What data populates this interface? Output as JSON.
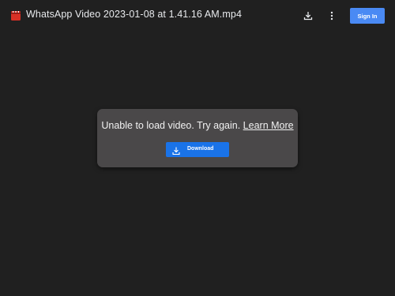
{
  "header": {
    "file_title": "WhatsApp Video 2023-01-08 at 1.41.16 AM.mp4",
    "file_icon": "video-file-icon",
    "download_icon": "download-icon",
    "more_icon": "more-vert-icon",
    "signin_label": "Sign In"
  },
  "error": {
    "message": "Unable to load video. Try again.",
    "learn_more": "Learn More",
    "download_label": "Download"
  },
  "colors": {
    "background": "#202020",
    "card": "#4a4849",
    "primary_button": "#1a73e8",
    "signin_button": "#4a8af4",
    "file_icon": "#d93025"
  }
}
